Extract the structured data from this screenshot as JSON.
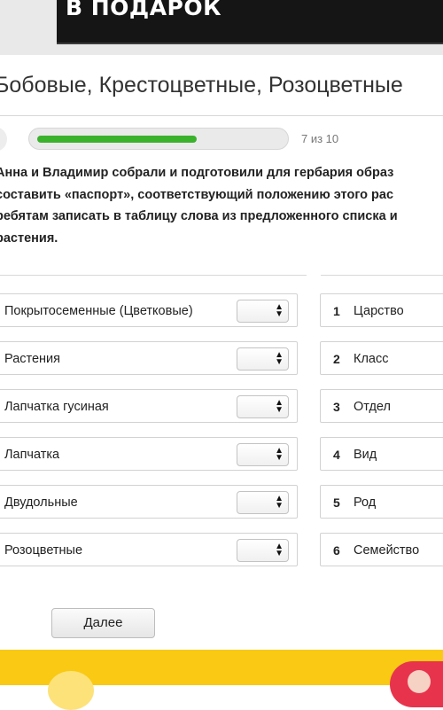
{
  "banner": {
    "text": "В ПОДАРОК"
  },
  "page_title": "Бобовые, Крестоцветные, Розоцветные",
  "progress": {
    "label": "7 из 10",
    "fraction": 0.7
  },
  "question": {
    "lines": [
      "Анна и Владимир собрали и подготовили для гербария образ",
      "составить «паспорт», соответствующий положению этого рас",
      "ребятам записать в таблицу слова из предложенного списка и",
      "растения."
    ]
  },
  "left_items": [
    {
      "label": "Покрытосеменные (Цветковые)",
      "selected": ""
    },
    {
      "label": "Растения",
      "selected": ""
    },
    {
      "label": "Лапчатка гусиная",
      "selected": ""
    },
    {
      "label": "Лапчатка",
      "selected": ""
    },
    {
      "label": "Двудольные",
      "selected": ""
    },
    {
      "label": "Розоцветные",
      "selected": ""
    }
  ],
  "right_items": [
    {
      "num": "1",
      "label": "Царство"
    },
    {
      "num": "2",
      "label": "Класс"
    },
    {
      "num": "3",
      "label": "Отдел"
    },
    {
      "num": "4",
      "label": "Вид"
    },
    {
      "num": "5",
      "label": "Род"
    },
    {
      "num": "6",
      "label": "Семейство"
    }
  ],
  "select_icon": "up-down-arrows-icon",
  "next_button": {
    "label": "Далее"
  },
  "colors": {
    "progress": "#3ab22c",
    "banner_bottom": "#f9c913",
    "banner_top": "#151515"
  }
}
